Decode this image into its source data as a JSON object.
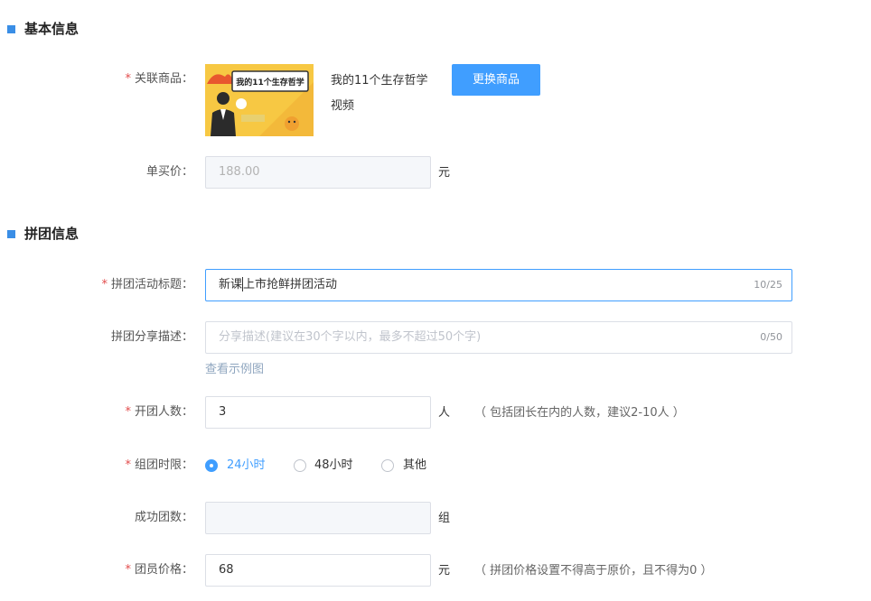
{
  "basic_section": {
    "title": "基本信息"
  },
  "product": {
    "label": "关联商品：",
    "name_line1": "我的11个生存哲学",
    "name_line2": "视频",
    "thumb_title": "我的11个生存哲学",
    "change_button": "更换商品"
  },
  "single_price": {
    "label": "单买价：",
    "value": "188.00",
    "unit": "元"
  },
  "group_section": {
    "title": "拼团信息"
  },
  "activity_title": {
    "label": "拼团活动标题：",
    "value_before_caret": "新课",
    "value_after_caret": "上市抢鲜拼团活动",
    "counter": "10/25"
  },
  "share_desc": {
    "label": "拼团分享描述：",
    "placeholder": "分享描述(建议在30个字以内，最多不超过50个字)",
    "counter": "0/50",
    "example_link": "查看示例图"
  },
  "group_size": {
    "label": "开团人数：",
    "value": "3",
    "unit": "人",
    "hint": "（ 包括团长在内的人数，建议2-10人 ）"
  },
  "time_limit": {
    "label": "组团时限：",
    "options": [
      "24小时",
      "48小时",
      "其他"
    ],
    "selected": "24小时"
  },
  "success_count": {
    "label": "成功团数：",
    "value": "",
    "unit": "组"
  },
  "member_price": {
    "label": "团员价格：",
    "value": "68",
    "unit": "元",
    "hint": "（ 拼团价格设置不得高于原价，且不得为0 ）"
  },
  "colors": {
    "accent": "#409eff",
    "section_marker": "#3a8ee6",
    "required_star": "#e24c4c",
    "thumb_background": "#f7c843"
  }
}
